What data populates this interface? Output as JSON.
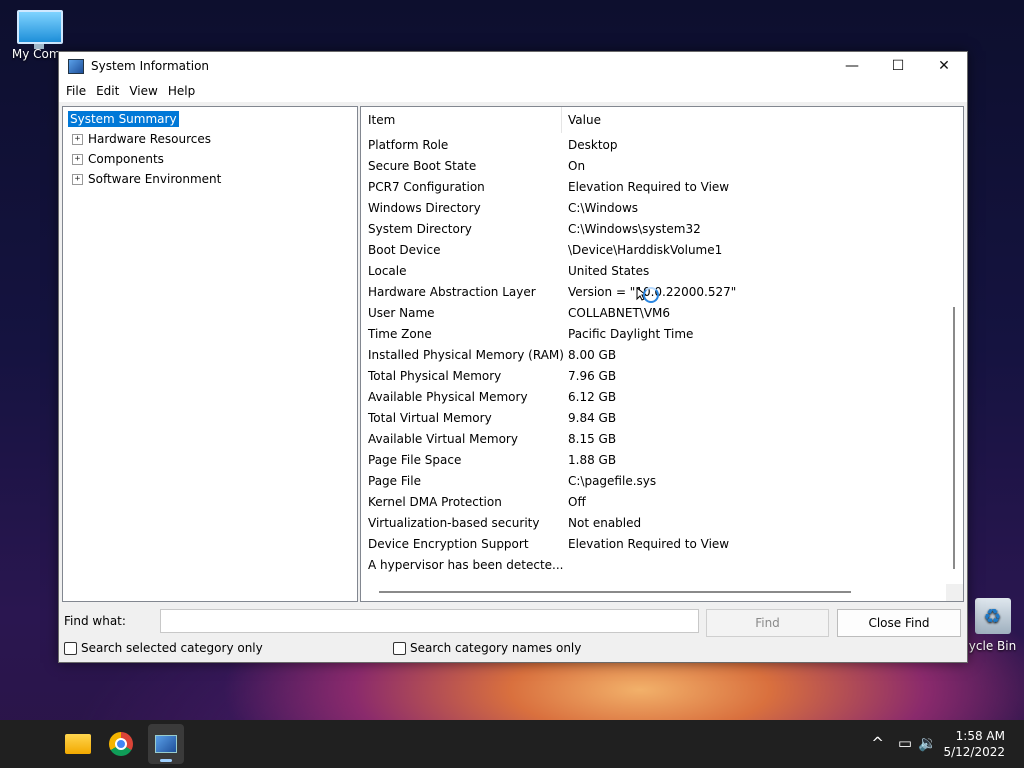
{
  "desktop": {
    "icons": [
      {
        "label": "My Comp"
      },
      {
        "label": "ycle Bin"
      }
    ]
  },
  "window": {
    "title": "System Information",
    "controls": {
      "minimize": "—",
      "maximize": "☐",
      "close": "✕"
    },
    "menu": [
      "File",
      "Edit",
      "View",
      "Help"
    ]
  },
  "tree": {
    "selected": "System Summary",
    "items": [
      {
        "label": "Hardware Resources",
        "expander": "+"
      },
      {
        "label": "Components",
        "expander": "+"
      },
      {
        "label": "Software Environment",
        "expander": "+"
      }
    ]
  },
  "list": {
    "columns": [
      "Item",
      "Value"
    ],
    "rows": [
      {
        "item": "Platform Role",
        "value": "Desktop"
      },
      {
        "item": "Secure Boot State",
        "value": "On"
      },
      {
        "item": "PCR7 Configuration",
        "value": "Elevation Required to View"
      },
      {
        "item": "Windows Directory",
        "value": "C:\\Windows"
      },
      {
        "item": "System Directory",
        "value": "C:\\Windows\\system32"
      },
      {
        "item": "Boot Device",
        "value": "\\Device\\HarddiskVolume1"
      },
      {
        "item": "Locale",
        "value": "United States"
      },
      {
        "item": "Hardware Abstraction Layer",
        "value": "Version = \"10.0.22000.527\""
      },
      {
        "item": "User Name",
        "value": "COLLABNET\\VM6"
      },
      {
        "item": "Time Zone",
        "value": "Pacific Daylight Time"
      },
      {
        "item": "Installed Physical Memory (RAM)",
        "value": "8.00 GB"
      },
      {
        "item": "Total Physical Memory",
        "value": "7.96 GB"
      },
      {
        "item": "Available Physical Memory",
        "value": "6.12 GB"
      },
      {
        "item": "Total Virtual Memory",
        "value": "9.84 GB"
      },
      {
        "item": "Available Virtual Memory",
        "value": "8.15 GB"
      },
      {
        "item": "Page File Space",
        "value": "1.88 GB"
      },
      {
        "item": "Page File",
        "value": "C:\\pagefile.sys"
      },
      {
        "item": "Kernel DMA Protection",
        "value": "Off"
      },
      {
        "item": "Virtualization-based security",
        "value": "Not enabled"
      },
      {
        "item": "Device Encryption Support",
        "value": "Elevation Required to View"
      },
      {
        "item": "A hypervisor has been detecte...",
        "value": ""
      }
    ]
  },
  "find": {
    "label": "Find what:",
    "value": "",
    "find_button": "Find",
    "close_button": "Close Find",
    "checkbox_selected": "Search selected category only",
    "checkbox_names": "Search category names only"
  },
  "taskbar": {
    "time": "1:58 AM",
    "date": "5/12/2022",
    "tray": {
      "chevron": "^",
      "network": "▭",
      "volume": "🔉"
    }
  },
  "colors": {
    "selection": "#0078d7",
    "taskbar": "#202020"
  }
}
